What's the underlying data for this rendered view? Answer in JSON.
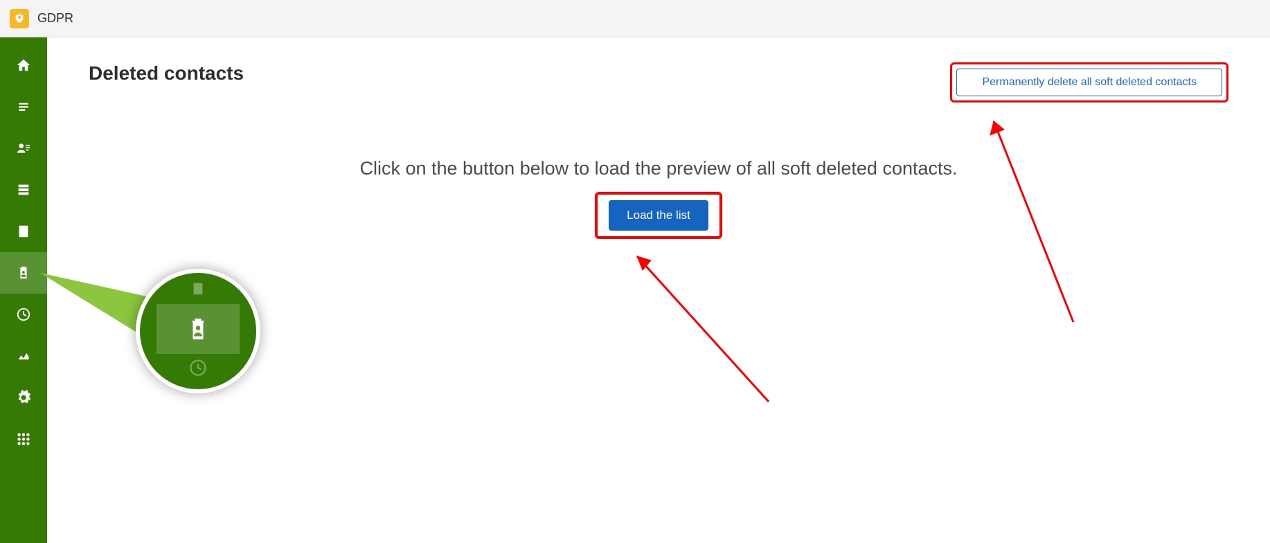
{
  "app": {
    "title": "GDPR"
  },
  "sidebar": {
    "items": [
      {
        "name": "home"
      },
      {
        "name": "menu"
      },
      {
        "name": "contacts"
      },
      {
        "name": "database"
      },
      {
        "name": "company"
      },
      {
        "name": "deleted-contacts",
        "selected": true
      },
      {
        "name": "pending"
      },
      {
        "name": "analytics"
      },
      {
        "name": "settings"
      },
      {
        "name": "apps-grid"
      }
    ]
  },
  "page": {
    "title": "Deleted contacts",
    "permanently_delete_label": "Permanently delete all soft deleted contacts",
    "instruction": "Click on the button below to load the preview of all soft deleted contacts.",
    "load_button_label": "Load the list"
  }
}
